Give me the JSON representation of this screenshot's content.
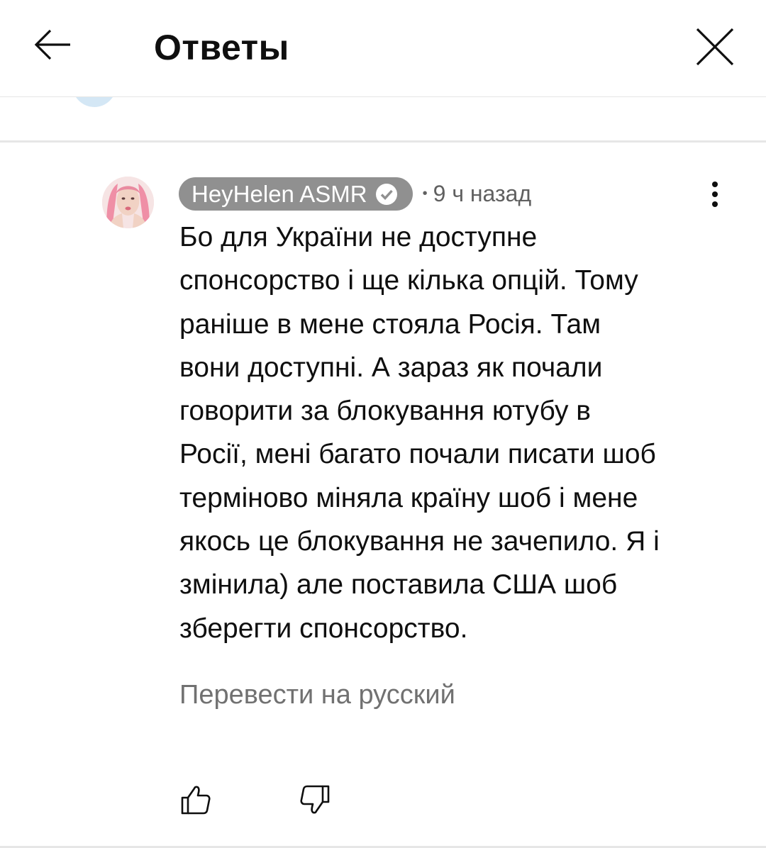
{
  "header": {
    "title": "Ответы",
    "back_icon": "arrow-left-icon",
    "close_icon": "close-icon"
  },
  "comment": {
    "author": "HeyHelen ASMR",
    "verified": true,
    "separator": "•",
    "time": "9 ч назад",
    "text_lines": [
      "Бо для України не доступне",
      "спонсорство і ще кілька опцій. Тому",
      "раніше в мене стояла Росія. Там",
      "вони доступні. А зараз як почали",
      "говорити за блокування ютубу в",
      "Росії, мені багато почали писати шоб",
      "терміново міняла країну шоб і мене",
      "якось це блокування не зачепило. Я і",
      "змінила) але поставила США шоб",
      "зберегти спонсорство."
    ],
    "translate_label": "Перевести на русский",
    "like_icon": "thumb-up-icon",
    "dislike_icon": "thumb-down-icon",
    "more_icon": "more-vertical-icon"
  },
  "colors": {
    "author_chip_bg": "#909090",
    "secondary_text": "#606060",
    "translate_text": "#717171",
    "divider": "#e6e6e6"
  }
}
